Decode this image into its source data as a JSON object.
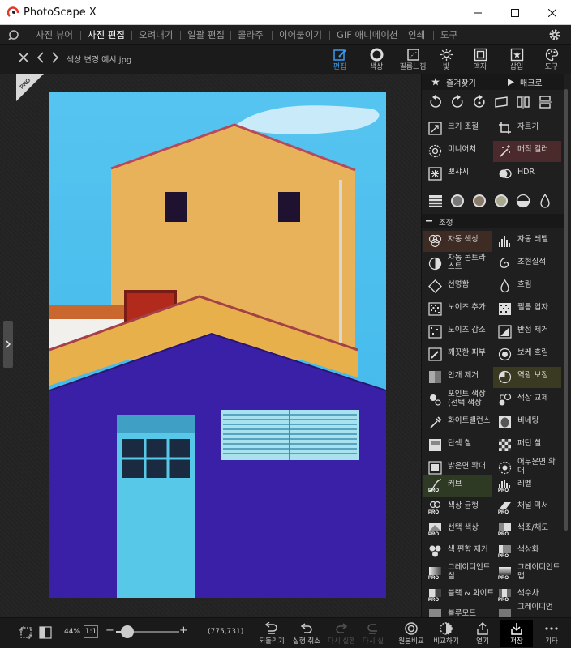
{
  "window": {
    "title": "PhotoScape X"
  },
  "menu": {
    "items": [
      {
        "label": "사진 뷰어"
      },
      {
        "label": "사진 편집"
      },
      {
        "label": "오려내기"
      },
      {
        "label": "일괄 편집"
      },
      {
        "label": "콜라주"
      },
      {
        "label": "이어붙이기"
      },
      {
        "label": "GIF 애니메이션"
      },
      {
        "label": "인쇄"
      },
      {
        "label": "도구"
      }
    ]
  },
  "toolbar": {
    "filename": "색상 변경 예시.jpg",
    "tabs": [
      {
        "label": "편집"
      },
      {
        "label": "색상"
      },
      {
        "label": "필름느낌"
      },
      {
        "label": "빛"
      },
      {
        "label": "액자"
      },
      {
        "label": "삽입"
      },
      {
        "label": "도구"
      }
    ]
  },
  "panel": {
    "favorites": "즐겨찾기",
    "macro": "매크로",
    "section_adjust": "조정",
    "tools_top": [
      {
        "label": "크기 조절"
      },
      {
        "label": "자르기"
      },
      {
        "label": "미니어처"
      },
      {
        "label": "매직 컬러"
      },
      {
        "label": "뽀샤시"
      },
      {
        "label": "HDR"
      }
    ],
    "tools_adjust": [
      {
        "label": "자동 색상"
      },
      {
        "label": "자동 레벨"
      },
      {
        "label": "자동 콘트라스트"
      },
      {
        "label": "초현실적"
      },
      {
        "label": "선명함"
      },
      {
        "label": "흐림"
      },
      {
        "label": "노이즈 추가"
      },
      {
        "label": "필름 입자"
      },
      {
        "label": "노이즈 감소"
      },
      {
        "label": "반점 제거"
      },
      {
        "label": "깨끗한 피부"
      },
      {
        "label": "보케 흐림"
      },
      {
        "label": "안개 제거"
      },
      {
        "label": "역광 보정"
      },
      {
        "label": "포인트 색상 (선택 색상"
      },
      {
        "label": "색상 교체"
      },
      {
        "label": "화이트밸런스"
      },
      {
        "label": "비네팅"
      },
      {
        "label": "단색 칠"
      },
      {
        "label": "패턴 칠"
      },
      {
        "label": "밝은면 확대"
      },
      {
        "label": "어두운면 확대"
      },
      {
        "label": "커브"
      },
      {
        "label": "레벨"
      },
      {
        "label": "색상 균형"
      },
      {
        "label": "채널 믹서"
      },
      {
        "label": "선택 색상"
      },
      {
        "label": "색조/채도"
      },
      {
        "label": "색 편향 제거"
      },
      {
        "label": "색상화"
      },
      {
        "label": "그레이디언트 칠"
      },
      {
        "label": "그레이디언트 맵"
      },
      {
        "label": "블랙 & 화이트"
      },
      {
        "label": "색수차"
      },
      {
        "label": "블루모드"
      },
      {
        "label": "그레이디언"
      }
    ],
    "pro_badge": "PRO"
  },
  "bottom": {
    "zoom": "44%",
    "one_to_one": "1:1",
    "coords": "(775,731)",
    "buttons": [
      {
        "label": "되돌리기"
      },
      {
        "label": "실행 취소"
      },
      {
        "label": "다시 실행"
      },
      {
        "label": "다시 실"
      },
      {
        "label": "원본비교"
      },
      {
        "label": "비교하기"
      },
      {
        "label": "열기"
      },
      {
        "label": "저장"
      },
      {
        "label": "기타"
      }
    ],
    "slider_level": 0.18
  },
  "colors": {
    "accent_blue": "#3a9af0",
    "sky": "#3fb8ec",
    "wall_yellow": "#eab35a",
    "wall_purple": "#3a22a8",
    "door_cyan": "#58c8e8"
  }
}
